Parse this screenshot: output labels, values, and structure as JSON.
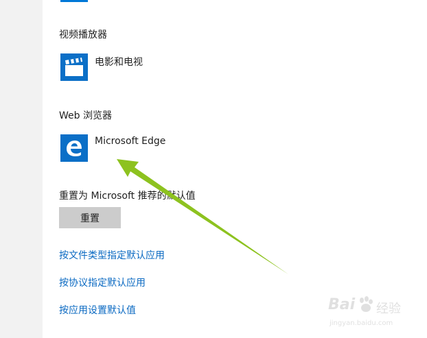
{
  "colors": {
    "accent": "#0078d7",
    "link": "#0a69c2",
    "arrow": "#8dc21f",
    "button_bg": "#cccccc"
  },
  "video_player": {
    "section_label": "视频播放器",
    "app_name": "电影和电视",
    "app_icon": "clapperboard-icon"
  },
  "web_browser": {
    "section_label": "Web 浏览器",
    "app_name": "Microsoft Edge",
    "app_icon": "edge-icon"
  },
  "reset": {
    "label": "重置为 Microsoft 推荐的默认值",
    "button_label": "重置"
  },
  "links": [
    "按文件类型指定默认应用",
    "按协议指定默认应用",
    "按应用设置默认值"
  ],
  "watermark": {
    "brand": "Bai",
    "brand_cn": "经验",
    "url": "jingyan.baidu.com"
  }
}
